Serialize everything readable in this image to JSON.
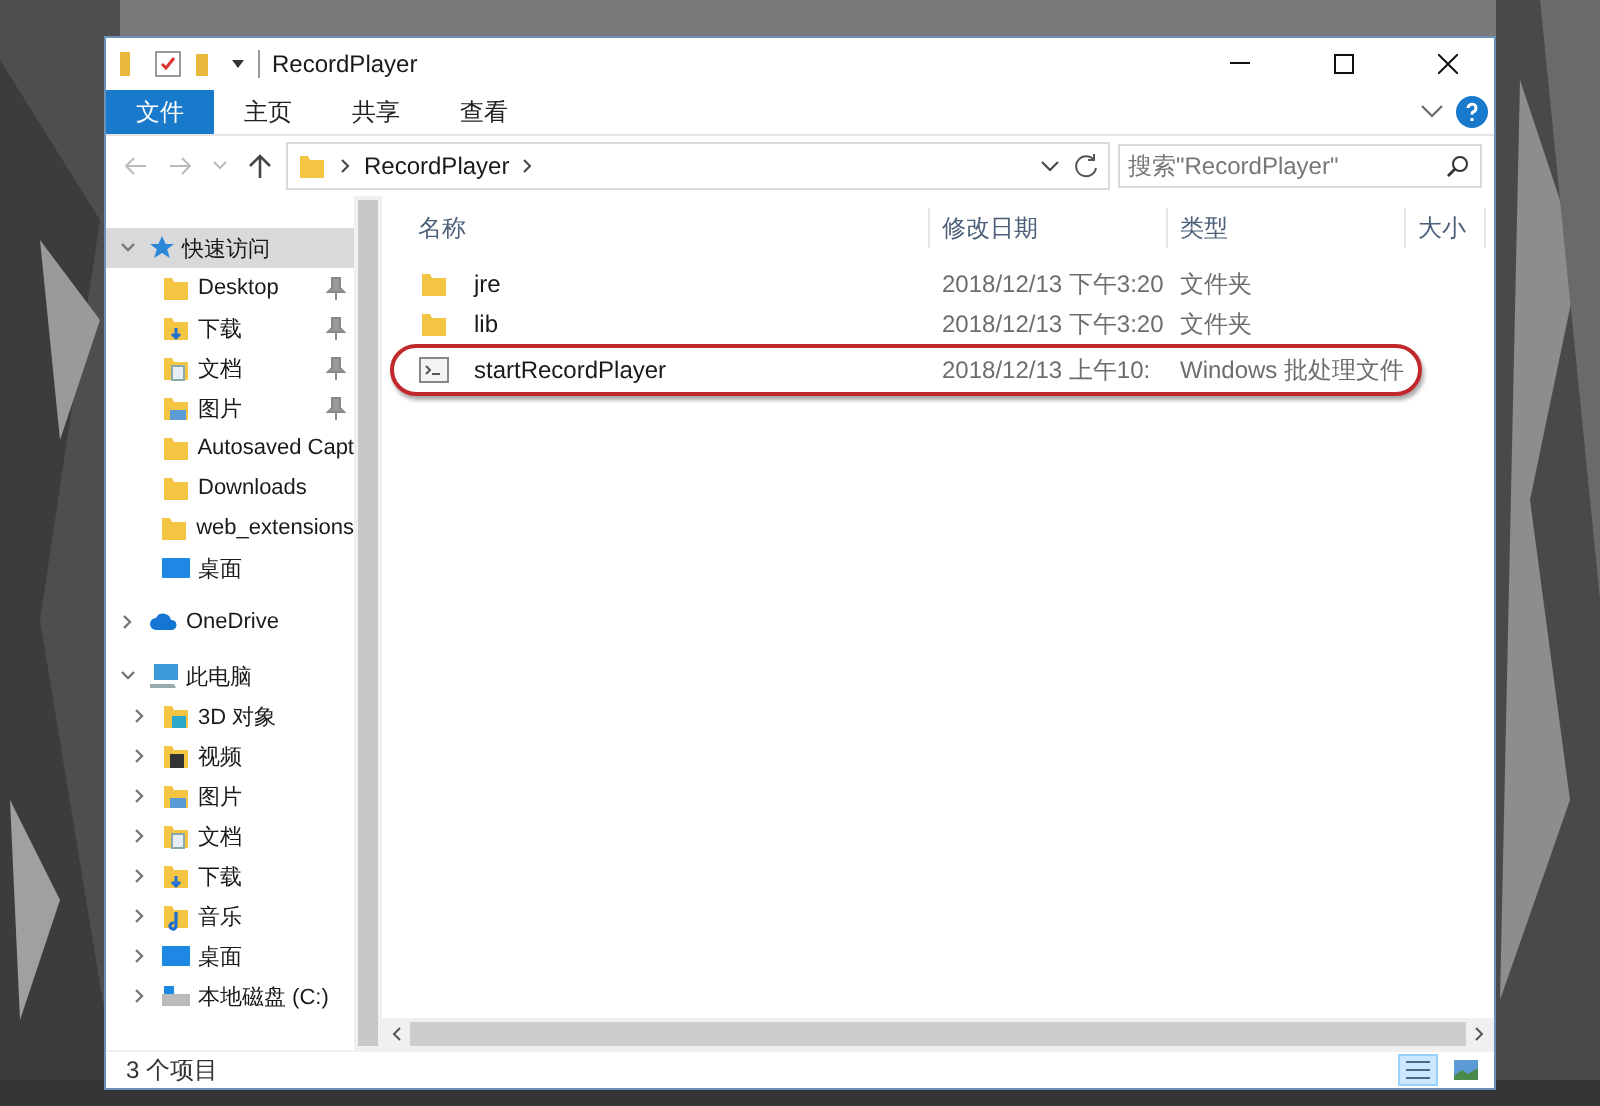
{
  "window": {
    "title": "RecordPlayer"
  },
  "ribbon_tabs": [
    {
      "label": "文件",
      "selected": true
    },
    {
      "label": "主页",
      "selected": false
    },
    {
      "label": "共享",
      "selected": false
    },
    {
      "label": "查看",
      "selected": false
    }
  ],
  "address": {
    "path": [
      "RecordPlayer"
    ],
    "search_placeholder": "搜索\"RecordPlayer\""
  },
  "sidebar": {
    "items": [
      {
        "label": "快速访问",
        "kind": "star",
        "expanded": true,
        "selected": true,
        "children": [
          {
            "label": "Desktop",
            "kind": "folder",
            "pinned": true
          },
          {
            "label": "下载",
            "kind": "download",
            "pinned": true
          },
          {
            "label": "文档",
            "kind": "document",
            "pinned": true
          },
          {
            "label": "图片",
            "kind": "pictures",
            "pinned": true
          },
          {
            "label": "Autosaved Capt",
            "kind": "folder",
            "pinned": false
          },
          {
            "label": "Downloads",
            "kind": "folder",
            "pinned": false
          },
          {
            "label": "web_extensions",
            "kind": "folder",
            "pinned": false
          },
          {
            "label": "桌面",
            "kind": "desktop",
            "pinned": false
          }
        ]
      },
      {
        "label": "OneDrive",
        "kind": "cloud",
        "expanded": false,
        "selected": false
      },
      {
        "label": "此电脑",
        "kind": "pc",
        "expanded": true,
        "selected": false,
        "children": [
          {
            "label": "3D 对象",
            "kind": "objects3d",
            "expanded": false
          },
          {
            "label": "视频",
            "kind": "video",
            "expanded": false
          },
          {
            "label": "图片",
            "kind": "pictures",
            "expanded": false
          },
          {
            "label": "文档",
            "kind": "document",
            "expanded": false
          },
          {
            "label": "下载",
            "kind": "download",
            "expanded": false
          },
          {
            "label": "音乐",
            "kind": "music",
            "expanded": false
          },
          {
            "label": "桌面",
            "kind": "desktop",
            "expanded": false
          },
          {
            "label": "本地磁盘 (C:)",
            "kind": "drive",
            "expanded": false
          }
        ]
      }
    ]
  },
  "table": {
    "columns": [
      "名称",
      "修改日期",
      "类型",
      "大小"
    ],
    "rows": [
      {
        "kind": "folder",
        "name": "jre",
        "date": "2018/12/13 下午3:20",
        "type": "文件夹",
        "circled": false
      },
      {
        "kind": "folder",
        "name": "lib",
        "date": "2018/12/13 下午3:20",
        "type": "文件夹",
        "circled": false
      },
      {
        "kind": "batch",
        "name": "startRecordPlayer",
        "date": "2018/12/13 上午10:",
        "type": "Windows 批处理文件",
        "circled": true
      }
    ]
  },
  "status_bar": {
    "text": "3 个项目",
    "views": [
      {
        "kind": "details",
        "selected": true
      },
      {
        "kind": "thumbnails",
        "selected": false
      }
    ]
  }
}
